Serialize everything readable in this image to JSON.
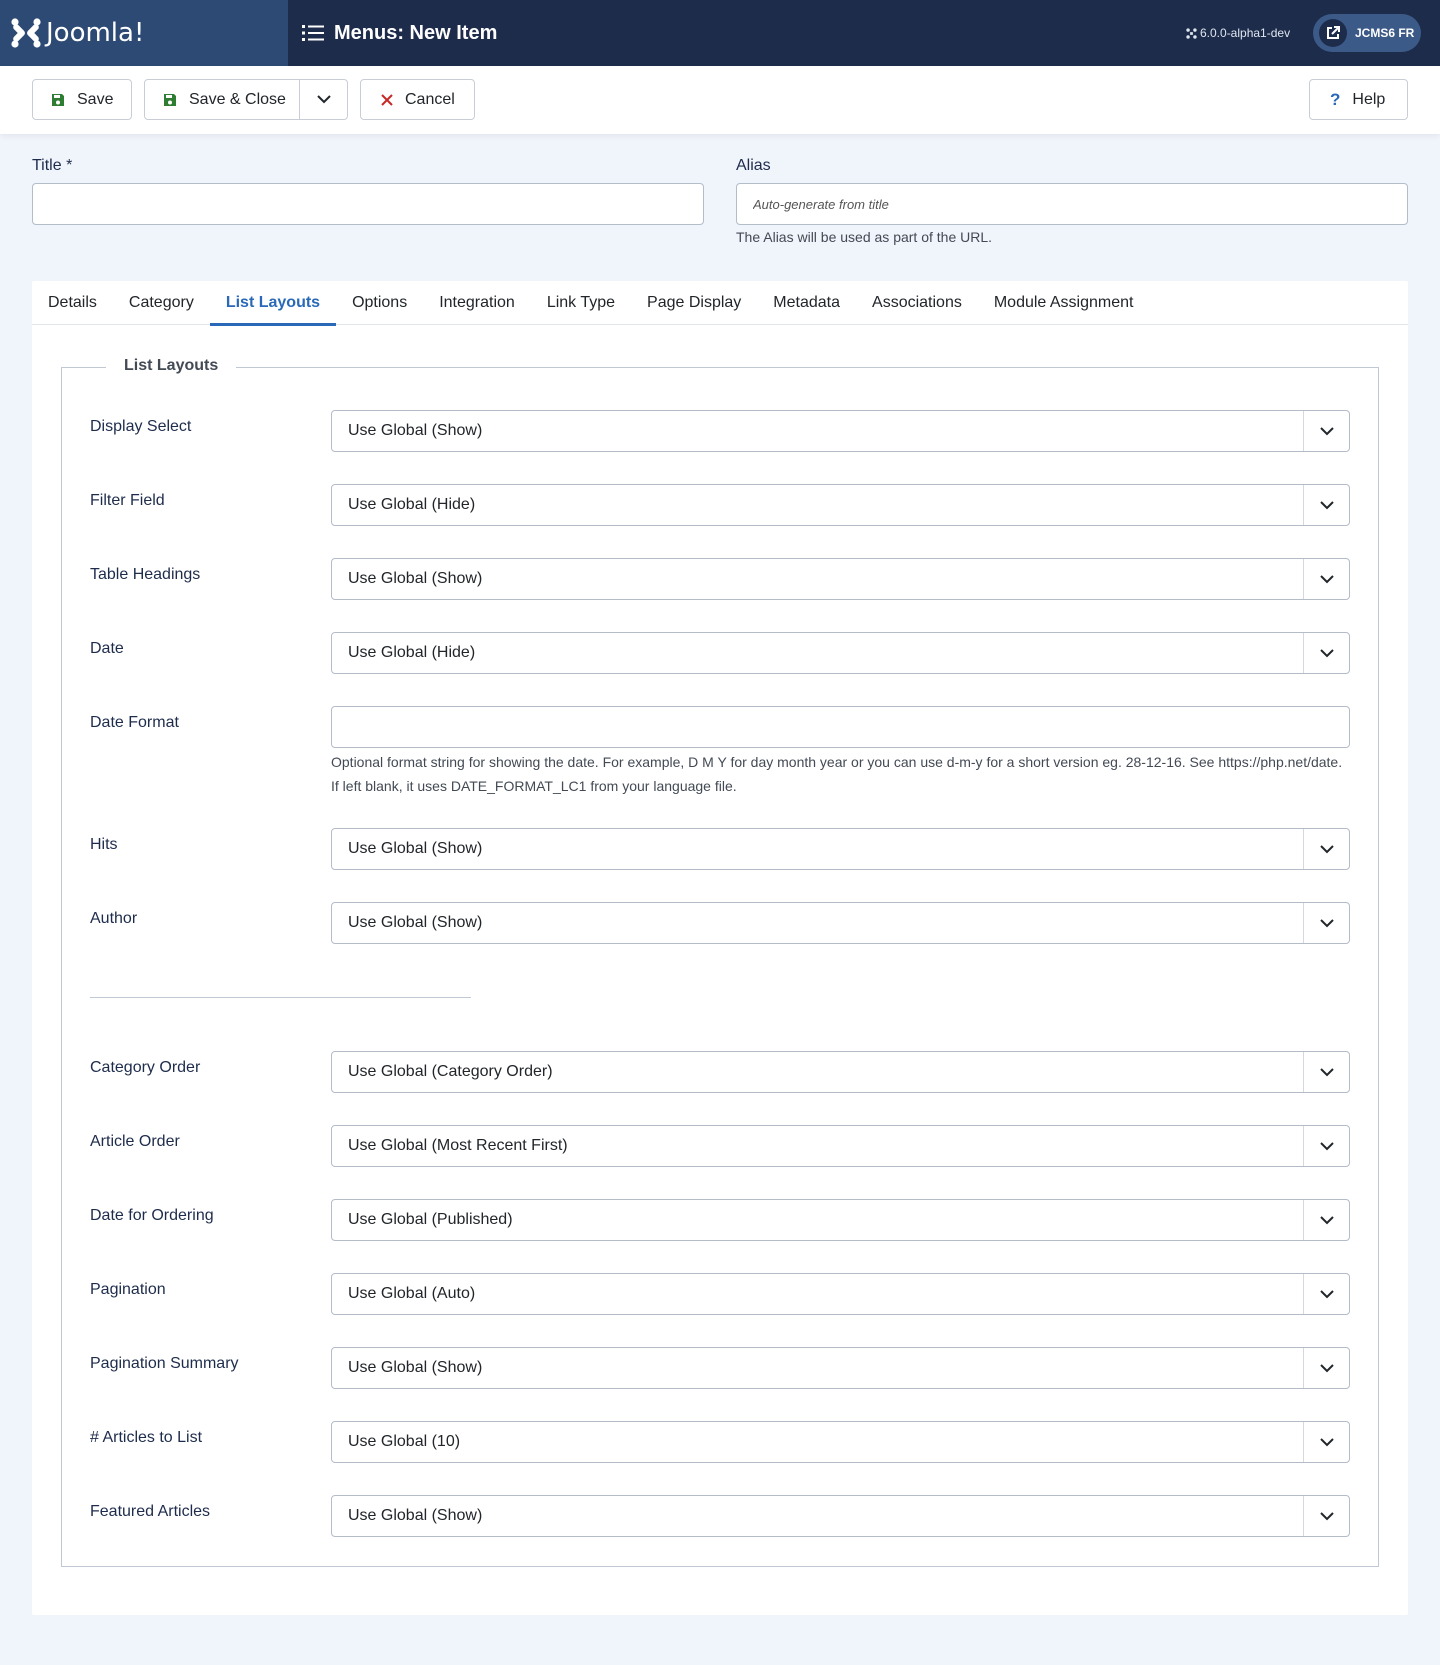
{
  "header": {
    "logo_text": "Joomla!",
    "page_title": "Menus: New Item",
    "version": "6.0.0-alpha1-dev",
    "site_button": "JCMS6 FR"
  },
  "toolbar": {
    "save_label": "Save",
    "save_close_label": "Save & Close",
    "cancel_label": "Cancel",
    "help_label": "Help"
  },
  "form": {
    "title_label": "Title *",
    "title_value": "",
    "alias_label": "Alias",
    "alias_placeholder": "Auto-generate from title",
    "alias_hint": "The Alias will be used as part of the URL."
  },
  "tabs": [
    {
      "label": "Details"
    },
    {
      "label": "Category"
    },
    {
      "label": "List Layouts",
      "active": true
    },
    {
      "label": "Options"
    },
    {
      "label": "Integration"
    },
    {
      "label": "Link Type"
    },
    {
      "label": "Page Display"
    },
    {
      "label": "Metadata"
    },
    {
      "label": "Associations"
    },
    {
      "label": "Module Assignment"
    }
  ],
  "list_layouts": {
    "legend": "List Layouts",
    "fields": [
      {
        "label": "Display Select",
        "value": "Use Global (Show)"
      },
      {
        "label": "Filter Field",
        "value": "Use Global (Hide)"
      },
      {
        "label": "Table Headings",
        "value": "Use Global (Show)"
      },
      {
        "label": "Date",
        "value": "Use Global (Hide)"
      },
      {
        "label": "Date Format",
        "value": "",
        "hint_line1": "Optional format string for showing the date. For example, D M Y for day month year or you can use d-m-y for a short version eg. 28-12-16. See https://php.net/date.",
        "hint_line2": "If left blank, it uses DATE_FORMAT_LC1 from your language file."
      },
      {
        "label": "Hits",
        "value": "Use Global (Show)"
      },
      {
        "label": "Author",
        "value": "Use Global (Show)"
      },
      {
        "label": "Category Order",
        "value": "Use Global (Category Order)"
      },
      {
        "label": "Article Order",
        "value": "Use Global (Most Recent First)"
      },
      {
        "label": "Date for Ordering",
        "value": "Use Global (Published)"
      },
      {
        "label": "Pagination",
        "value": "Use Global (Auto)"
      },
      {
        "label": "Pagination Summary",
        "value": "Use Global (Show)"
      },
      {
        "label": "# Articles to List",
        "value": "Use Global (10)"
      },
      {
        "label": "Featured Articles",
        "value": "Use Global (Show)"
      }
    ]
  },
  "colors": {
    "header_bg": "#1e2c4c",
    "logo_bg": "#2d4a74",
    "accent": "#2a69b8",
    "save_icon": "#2f7d32",
    "cancel_icon": "#c52827"
  }
}
